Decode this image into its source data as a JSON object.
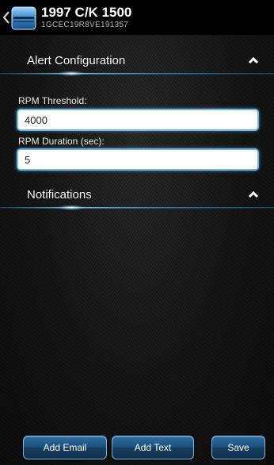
{
  "header": {
    "title": "1997 C/K 1500",
    "vin": "1GCEC19R8VE191357"
  },
  "sections": {
    "alert_configuration": {
      "title": "Alert Configuration",
      "expanded": true
    },
    "notifications": {
      "title": "Notifications",
      "expanded": true
    }
  },
  "fields": {
    "rpm_threshold": {
      "label": "RPM Threshold:",
      "value": "4000"
    },
    "rpm_duration": {
      "label": "RPM Duration (sec):",
      "value": "5"
    }
  },
  "actions": {
    "add_email": "Add Email",
    "add_text": "Add Text",
    "save": "Save"
  },
  "colors": {
    "accent": "#4fb3ff",
    "header_bg": "#000000",
    "button_bg": "#1c4f7a"
  }
}
